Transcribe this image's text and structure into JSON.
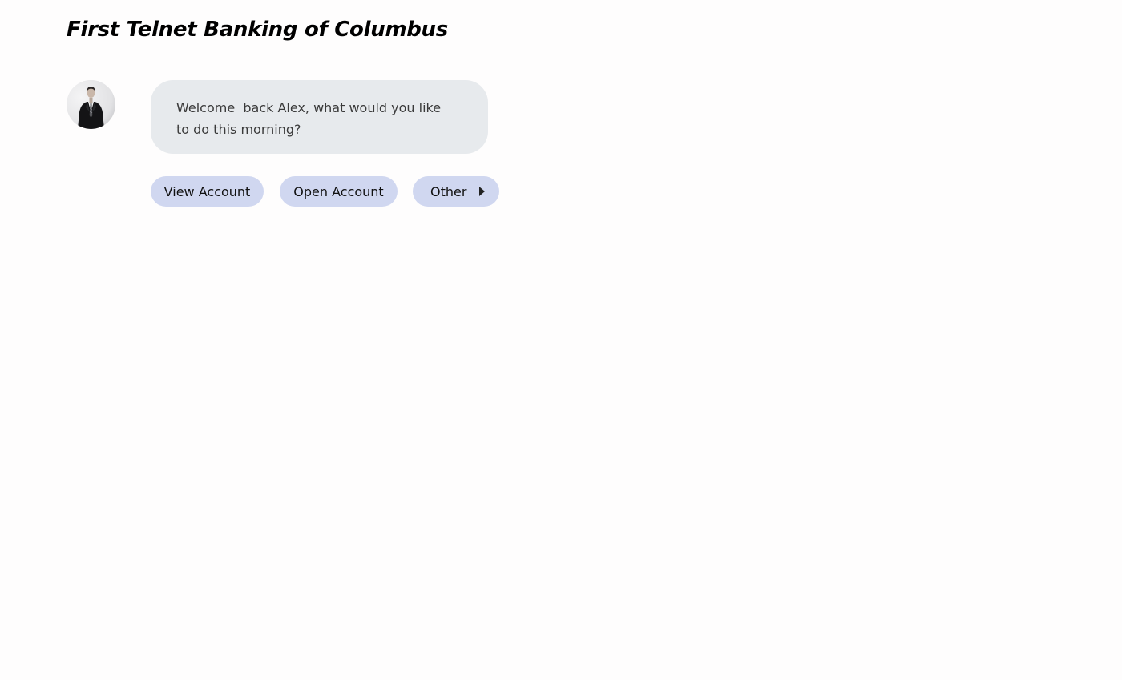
{
  "header": {
    "title": "First Telnet Banking of Columbus"
  },
  "chat": {
    "avatar_icon": "businessman-avatar",
    "message": "Welcome  back Alex, what would you like to do this morning?"
  },
  "quick_replies": {
    "view_account_label": "View Account",
    "open_account_label": "Open Account",
    "other_label": "Other",
    "other_icon": "caret-right-icon"
  },
  "colors": {
    "background": "#fefdfd",
    "bubble": "#e7eaed",
    "chip": "#d0d7f0",
    "title": "#000000"
  }
}
